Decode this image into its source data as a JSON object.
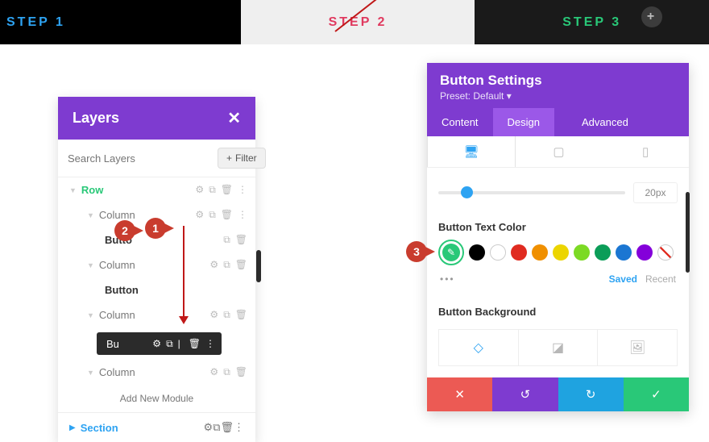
{
  "steps": {
    "s1": "STEP 1",
    "s2": "STEP 2",
    "s3": "STEP 3"
  },
  "layers": {
    "title": "Layers",
    "search_placeholder": "Search Layers",
    "filter_label": "Filter",
    "row_label": "Row",
    "column_label": "Column",
    "button_label": "Button",
    "button_partial_1": "Butto",
    "button_partial_2": "Bu",
    "add_module": "Add New Module",
    "section_label": "Section"
  },
  "markers": {
    "m1": "1",
    "m2": "2",
    "m3": "3"
  },
  "settings": {
    "title": "Button Settings",
    "preset": "Preset: Default ▾",
    "tabs": {
      "content": "Content",
      "design": "Design",
      "advanced": "Advanced"
    },
    "slider_value": "20px",
    "section_text_color": "Button Text Color",
    "saved": "Saved",
    "recent": "Recent",
    "section_bg": "Button Background"
  }
}
